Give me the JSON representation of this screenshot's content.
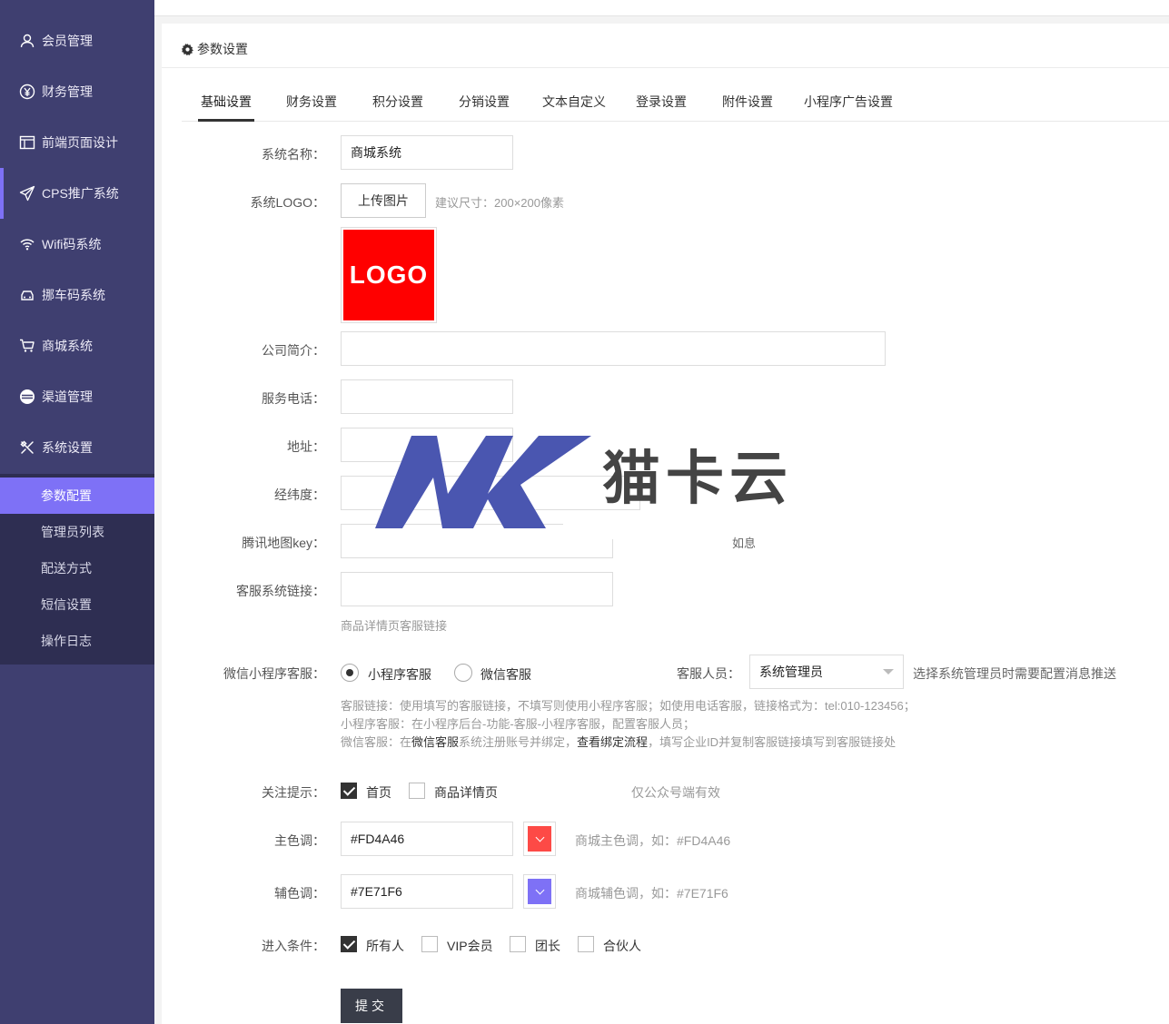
{
  "sidebar": {
    "items": [
      {
        "label": "会员管理",
        "icon": "user-icon"
      },
      {
        "label": "财务管理",
        "icon": "yen-icon"
      },
      {
        "label": "前端页面设计",
        "icon": "layout-icon"
      },
      {
        "label": "CPS推广系统",
        "icon": "send-icon"
      },
      {
        "label": "Wifi码系统",
        "icon": "wifi-icon"
      },
      {
        "label": "挪车码系统",
        "icon": "car-icon"
      },
      {
        "label": "商城系统",
        "icon": "cart-icon"
      },
      {
        "label": "渠道管理",
        "icon": "channel-icon"
      },
      {
        "label": "系统设置",
        "icon": "tools-icon"
      }
    ],
    "sub_items": [
      {
        "label": "参数配置"
      },
      {
        "label": "管理员列表"
      },
      {
        "label": "配送方式"
      },
      {
        "label": "短信设置"
      },
      {
        "label": "操作日志"
      }
    ]
  },
  "panel": {
    "title": "参数设置"
  },
  "tabs": [
    {
      "label": "基础设置"
    },
    {
      "label": "财务设置"
    },
    {
      "label": "积分设置"
    },
    {
      "label": "分销设置"
    },
    {
      "label": "文本自定义"
    },
    {
      "label": "登录设置"
    },
    {
      "label": "附件设置"
    },
    {
      "label": "小程序广告设置"
    }
  ],
  "form": {
    "system_name": {
      "label": "系统名称：",
      "value": "商城系统"
    },
    "system_logo": {
      "label": "系统LOGO：",
      "upload_label": "上传图片",
      "hint": "建议尺寸：200×200像素",
      "logo_text": "LOGO"
    },
    "company_intro": {
      "label": "公司简介："
    },
    "service_phone": {
      "label": "服务电话："
    },
    "address": {
      "label": "地址："
    },
    "lat_lng": {
      "label": "经纬度："
    },
    "tencent_map_key": {
      "label": "腾讯地图key：",
      "hint_fragment": "如息"
    },
    "service_link": {
      "label": "客服系统链接：",
      "hint": "商品详情页客服链接"
    },
    "wechat_service": {
      "label": "微信小程序客服：",
      "option_mini": "小程序客服",
      "option_wechat": "微信客服",
      "staff_label": "客服人员：",
      "staff_value": "系统管理员",
      "staff_hint": "选择系统管理员时需要配置消息推送",
      "note_line1": "客服链接：使用填写的客服链接，不填写则使用小程序客服；如使用电话客服，链接格式为：tel:010-123456；",
      "note_line2": "小程序客服：在小程序后台-功能-客服-小程序客服，配置客服人员；",
      "note_line3_a": "微信客服：在",
      "note_line3_b": "微信客服",
      "note_line3_c": "系统注册账号并绑定，",
      "note_line3_d": "查看绑定流程",
      "note_line3_e": "，填写企业ID并复制客服链接填写到客服链接处"
    },
    "follow_tip": {
      "label": "关注提示：",
      "opt_home": "首页",
      "opt_detail": "商品详情页",
      "hint": "仅公众号端有效"
    },
    "main_color": {
      "label": "主色调：",
      "value": "#FD4A46",
      "hint": "商城主色调，如：#FD4A46",
      "color": "#FD4A46"
    },
    "sub_color": {
      "label": "辅色调：",
      "value": "#7E71F6",
      "hint": "商城辅色调，如：#7E71F6",
      "color": "#7E71F6"
    },
    "entry_condition": {
      "label": "进入条件：",
      "opt_all": "所有人",
      "opt_vip": "VIP会员",
      "opt_leader": "团长",
      "opt_partner": "合伙人"
    },
    "submit_label": "提交"
  },
  "watermark": {
    "text": "猫卡云",
    "mark": "MK"
  }
}
